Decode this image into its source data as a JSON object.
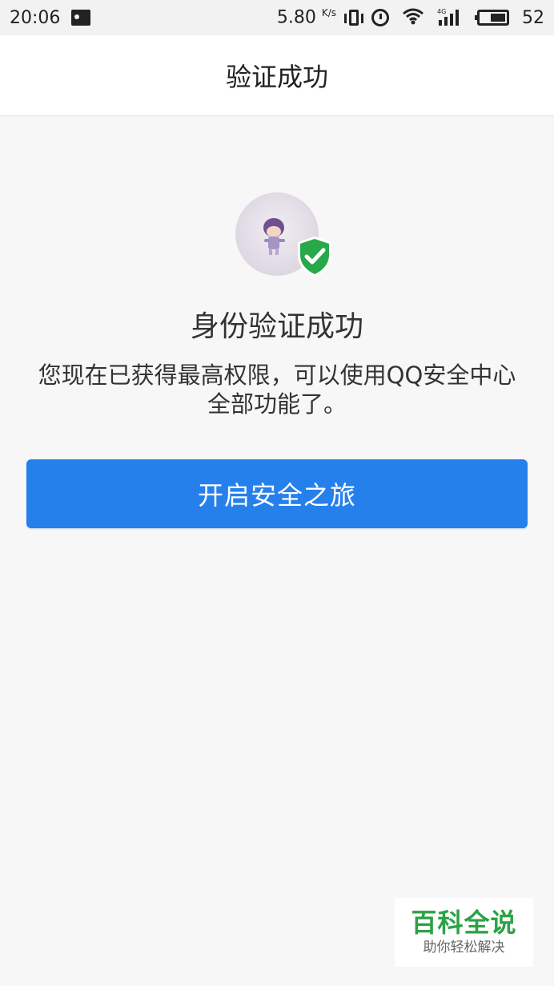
{
  "status_bar": {
    "time": "20:06",
    "speed_value": "5.80",
    "speed_unit": "K/s",
    "battery": "52",
    "network_type": "4G",
    "signal_strength": "4/4",
    "icons": [
      "image-notification-icon",
      "vibrate-icon",
      "alarm-icon",
      "wifi-icon",
      "signal-icon",
      "battery-icon"
    ]
  },
  "header": {
    "title": "验证成功"
  },
  "main": {
    "headline": "身份验证成功",
    "description_line1": "您现在已获得最高权限，可以使用QQ安全中心",
    "description_line2": "全部功能了。",
    "button_label": "开启安全之旅"
  },
  "watermark": {
    "title": "百科全说",
    "subtitle": "助你轻松解决"
  },
  "colors": {
    "accent": "#2580ec",
    "shield": "#27a94a",
    "background": "#f7f7f8",
    "watermark_green": "#2ba245"
  }
}
